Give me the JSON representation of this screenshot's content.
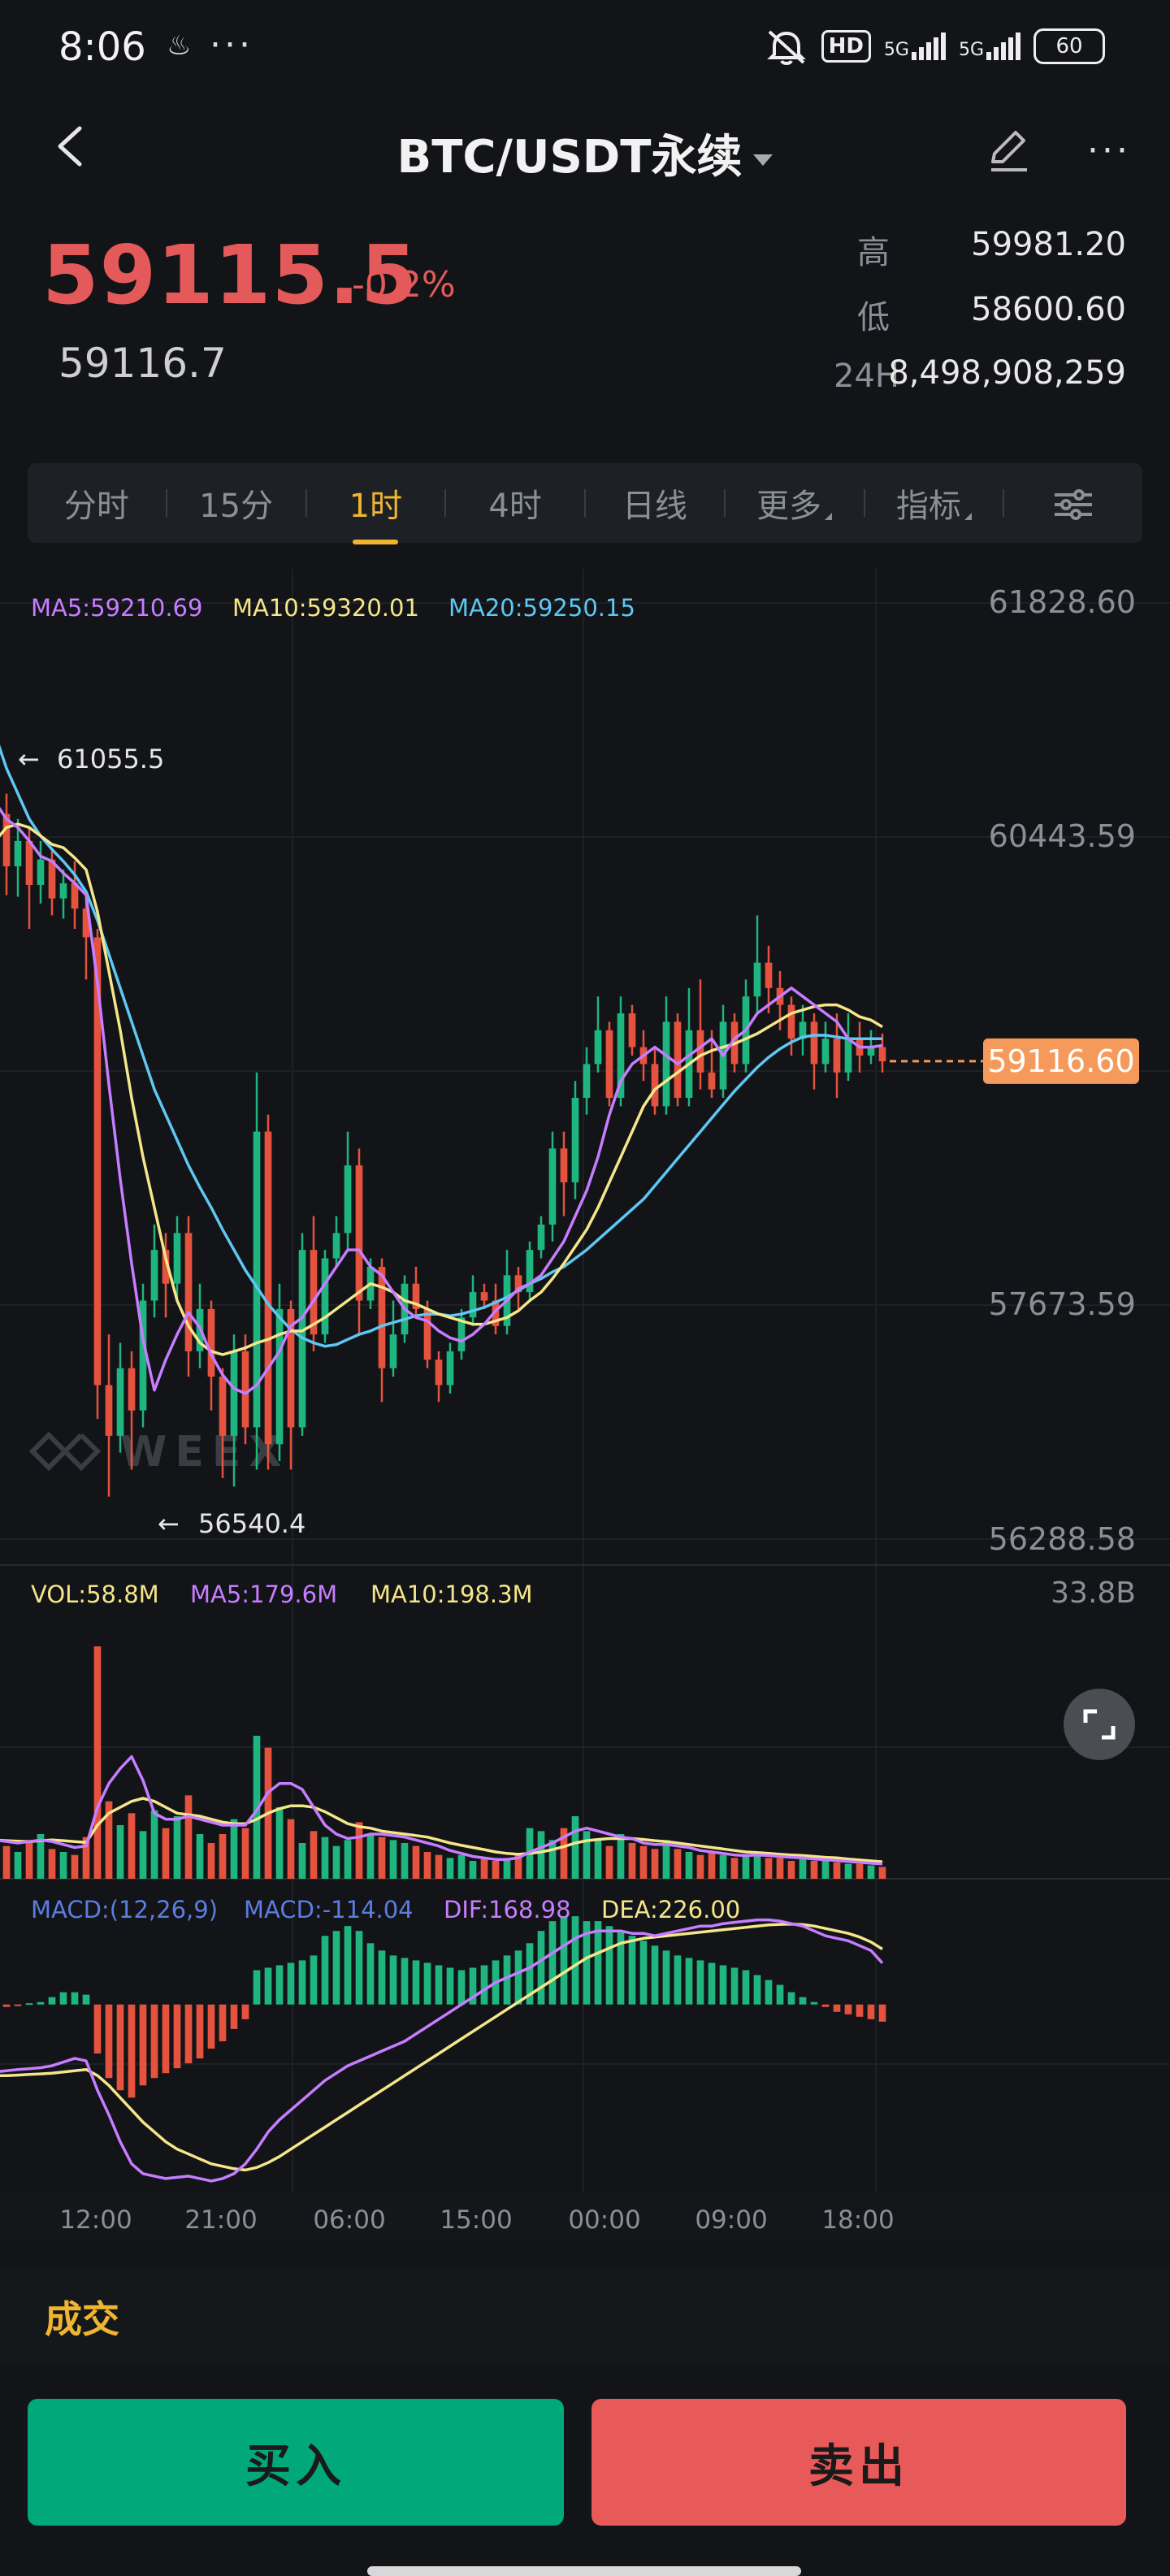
{
  "status_bar": {
    "time": "8:06",
    "glyph": "♨",
    "dots": "···",
    "hd": "HD",
    "net1": "5G",
    "net2": "5G",
    "battery": "60"
  },
  "nav": {
    "title": "BTC/USDT永续",
    "more": "···"
  },
  "price": {
    "last": "59115.5",
    "change": "-0.2%",
    "mark": "59116.7"
  },
  "stats": [
    {
      "label": "高",
      "value": "59981.20"
    },
    {
      "label": "低",
      "value": "58600.60"
    },
    {
      "label": "24H",
      "value": "8,498,908,259"
    }
  ],
  "tabs": [
    "分时",
    "15分",
    "1时",
    "4时",
    "日线",
    "更多",
    "指标"
  ],
  "active_tab": "1时",
  "colors": {
    "up": "#1fb57f",
    "down": "#e5533f",
    "ma5": "#c77dff",
    "ma10": "#f5e68a",
    "ma20": "#5ec8f2",
    "accent": "#f0b530",
    "bg": "#121417"
  },
  "chart_data": {
    "type": "candlestick",
    "main": {
      "legend": [
        {
          "name": "MA5",
          "text": "MA5:59210.69"
        },
        {
          "name": "MA10",
          "text": "MA10:59320.01"
        },
        {
          "name": "MA20",
          "text": "MA20:59250.15"
        }
      ],
      "y_labels": [
        "61828.60",
        "60443.59",
        "57673.59",
        "56288.58"
      ],
      "ylim": [
        56288.58,
        61828.6
      ],
      "high_mark": "61055.5",
      "low_mark": "56540.4",
      "current_price": "59116.60",
      "watermark": "WEEX",
      "candles": [
        [
          60440,
          60830,
          60310,
          61055
        ],
        [
          60830,
          60580,
          60450,
          60980
        ],
        [
          60580,
          60270,
          60100,
          60700
        ],
        [
          60270,
          60420,
          60090,
          60550
        ],
        [
          60420,
          60160,
          59900,
          60500
        ],
        [
          60160,
          60310,
          60050,
          60420
        ],
        [
          60310,
          60080,
          59980,
          60380
        ],
        [
          60080,
          60170,
          59960,
          60250
        ],
        [
          60170,
          60020,
          59900,
          60300
        ],
        [
          60020,
          59850,
          59600,
          60100
        ],
        [
          59850,
          57200,
          57000,
          59900
        ],
        [
          57200,
          56900,
          56540,
          57500
        ],
        [
          56900,
          57300,
          56800,
          57450
        ],
        [
          57300,
          57050,
          56700,
          57400
        ],
        [
          57050,
          57700,
          56950,
          57800
        ],
        [
          57700,
          58000,
          57600,
          58150
        ],
        [
          58000,
          57800,
          57600,
          58100
        ],
        [
          57800,
          58100,
          57700,
          58200
        ],
        [
          58100,
          57400,
          57250,
          58200
        ],
        [
          57400,
          57650,
          57300,
          57800
        ],
        [
          57650,
          57250,
          57050,
          57700
        ],
        [
          57250,
          56900,
          56650,
          57300
        ],
        [
          56900,
          57400,
          56600,
          57500
        ],
        [
          57400,
          56950,
          56850,
          57500
        ],
        [
          56950,
          58700,
          56700,
          59050
        ],
        [
          58700,
          56850,
          56700,
          58800
        ],
        [
          56850,
          57650,
          56750,
          57800
        ],
        [
          57650,
          56950,
          56700,
          57700
        ],
        [
          56950,
          58000,
          56900,
          58100
        ],
        [
          58000,
          57500,
          57400,
          58200
        ],
        [
          57500,
          57950,
          57450,
          58000
        ],
        [
          57950,
          58100,
          57900,
          58200
        ],
        [
          58100,
          58500,
          58000,
          58700
        ],
        [
          58500,
          57700,
          57500,
          58600
        ],
        [
          57700,
          57900,
          57650,
          57950
        ],
        [
          57900,
          57300,
          57100,
          57950
        ],
        [
          57300,
          57500,
          57250,
          57700
        ],
        [
          57500,
          57800,
          57450,
          57850
        ],
        [
          57800,
          57650,
          57600,
          57900
        ],
        [
          57650,
          57350,
          57300,
          57700
        ],
        [
          57350,
          57200,
          57100,
          57400
        ],
        [
          57200,
          57400,
          57150,
          57450
        ],
        [
          57400,
          57600,
          57350,
          57650
        ],
        [
          57600,
          57750,
          57550,
          57850
        ],
        [
          57750,
          57700,
          57650,
          57800
        ],
        [
          57700,
          57550,
          57500,
          57800
        ],
        [
          57550,
          57850,
          57500,
          58000
        ],
        [
          57850,
          57750,
          57650,
          57900
        ],
        [
          57750,
          58000,
          57700,
          58050
        ],
        [
          58000,
          58150,
          57950,
          58200
        ],
        [
          58150,
          58600,
          58050,
          58700
        ],
        [
          58600,
          58400,
          58200,
          58700
        ],
        [
          58400,
          58900,
          58300,
          59000
        ],
        [
          58900,
          59100,
          58800,
          59200
        ],
        [
          59100,
          59300,
          59050,
          59500
        ],
        [
          59300,
          58900,
          58850,
          59350
        ],
        [
          58900,
          59400,
          58850,
          59500
        ],
        [
          59400,
          59200,
          59150,
          59450
        ],
        [
          59200,
          59100,
          59000,
          59300
        ],
        [
          59100,
          58850,
          58800,
          59200
        ],
        [
          58850,
          59350,
          58800,
          59500
        ],
        [
          59350,
          58900,
          58850,
          59400
        ],
        [
          58900,
          59300,
          58850,
          59550
        ],
        [
          59300,
          59050,
          58950,
          59600
        ],
        [
          59050,
          58950,
          58900,
          59300
        ],
        [
          58950,
          59350,
          58900,
          59450
        ],
        [
          59350,
          59100,
          59050,
          59400
        ],
        [
          59100,
          59500,
          59050,
          59600
        ],
        [
          59500,
          59700,
          59400,
          59980
        ],
        [
          59700,
          59550,
          59400,
          59800
        ],
        [
          59550,
          59450,
          59300,
          59650
        ],
        [
          59450,
          59250,
          59150,
          59500
        ],
        [
          59250,
          59350,
          59150,
          59450
        ],
        [
          59350,
          59100,
          58950,
          59400
        ],
        [
          59100,
          59250,
          59050,
          59350
        ],
        [
          59250,
          59050,
          58900,
          59400
        ],
        [
          59050,
          59250,
          59000,
          59400
        ],
        [
          59250,
          59150,
          59050,
          59350
        ],
        [
          59150,
          59200,
          59100,
          59300
        ],
        [
          59200,
          59116,
          59050,
          59280
        ]
      ],
      "ma5": [
        60600,
        60650,
        60550,
        60500,
        60420,
        60330,
        60300,
        60230,
        60170,
        60100,
        59580,
        58980,
        58420,
        57920,
        57470,
        57170,
        57350,
        57500,
        57630,
        57540,
        57380,
        57260,
        57180,
        57150,
        57200,
        57300,
        57400,
        57550,
        57600,
        57700,
        57800,
        57900,
        58000,
        58000,
        57900,
        57850,
        57750,
        57650,
        57600,
        57580,
        57520,
        57480,
        57460,
        57500,
        57560,
        57640,
        57700,
        57770,
        57800,
        57850,
        57950,
        58050,
        58200,
        58350,
        58550,
        58800,
        59000,
        59100,
        59150,
        59200,
        59150,
        59100,
        59150,
        59200,
        59250,
        59150,
        59250,
        59300,
        59400,
        59450,
        59500,
        59550,
        59500,
        59450,
        59400,
        59350,
        59250,
        59200,
        59200,
        59210
      ],
      "ma10": [
        60350,
        60420,
        60500,
        60520,
        60500,
        60450,
        60400,
        60380,
        60320,
        60250,
        60000,
        59650,
        59300,
        58900,
        58550,
        58250,
        57950,
        57700,
        57550,
        57450,
        57400,
        57380,
        57400,
        57420,
        57450,
        57470,
        57500,
        57520,
        57520,
        57560,
        57600,
        57650,
        57700,
        57750,
        57800,
        57780,
        57750,
        57700,
        57680,
        57650,
        57620,
        57600,
        57580,
        57560,
        57560,
        57580,
        57600,
        57640,
        57700,
        57750,
        57830,
        57920,
        58020,
        58120,
        58250,
        58400,
        58550,
        58700,
        58850,
        58950,
        59000,
        59050,
        59100,
        59150,
        59180,
        59200,
        59220,
        59250,
        59280,
        59320,
        59360,
        59400,
        59420,
        59440,
        59450,
        59450,
        59420,
        59380,
        59360,
        59320
      ],
      "ma20": [
        61200,
        61050,
        60850,
        60700,
        60550,
        60450,
        60370,
        60300,
        60220,
        60120,
        59950,
        59750,
        59550,
        59350,
        59150,
        58950,
        58800,
        58650,
        58500,
        58370,
        58250,
        58120,
        58000,
        57880,
        57780,
        57680,
        57600,
        57530,
        57480,
        57450,
        57430,
        57440,
        57470,
        57500,
        57520,
        57550,
        57570,
        57590,
        57610,
        57620,
        57620,
        57610,
        57620,
        57640,
        57660,
        57690,
        57720,
        57760,
        57800,
        57830,
        57870,
        57900,
        57950,
        58000,
        58060,
        58120,
        58180,
        58240,
        58300,
        58380,
        58460,
        58540,
        58620,
        58700,
        58780,
        58860,
        58940,
        59010,
        59080,
        59140,
        59190,
        59230,
        59260,
        59270,
        59270,
        59260,
        59250,
        59250,
        59250,
        59250
      ]
    },
    "volume": {
      "legend": [
        {
          "name": "VOL",
          "text": "VOL:58.8M"
        },
        {
          "name": "MA5",
          "text": "MA5:179.6M"
        },
        {
          "name": "MA10",
          "text": "MA10:198.3M"
        }
      ],
      "y_label": "33.8B",
      "values": [
        120,
        160,
        110,
        90,
        130,
        150,
        100,
        90,
        80,
        140,
        780,
        260,
        180,
        220,
        160,
        230,
        170,
        210,
        280,
        150,
        120,
        150,
        200,
        170,
        480,
        440,
        240,
        200,
        120,
        160,
        140,
        110,
        130,
        190,
        150,
        140,
        130,
        120,
        110,
        90,
        80,
        70,
        80,
        60,
        70,
        60,
        70,
        80,
        170,
        160,
        130,
        170,
        210,
        160,
        130,
        110,
        150,
        120,
        110,
        100,
        130,
        100,
        90,
        80,
        90,
        80,
        70,
        80,
        90,
        70,
        70,
        60,
        70,
        60,
        60,
        55,
        50,
        50,
        45,
        40
      ],
      "ma5": [
        120,
        130,
        125,
        120,
        125,
        130,
        125,
        115,
        105,
        110,
        240,
        320,
        370,
        410,
        330,
        220,
        200,
        200,
        210,
        200,
        190,
        180,
        180,
        180,
        230,
        290,
        320,
        320,
        300,
        240,
        180,
        150,
        135,
        140,
        150,
        150,
        145,
        140,
        130,
        120,
        110,
        95,
        85,
        75,
        70,
        65,
        65,
        70,
        90,
        105,
        120,
        140,
        160,
        170,
        160,
        150,
        140,
        135,
        120,
        115,
        115,
        110,
        105,
        95,
        90,
        85,
        80,
        78,
        80,
        78,
        75,
        72,
        70,
        66,
        64,
        61,
        58,
        55,
        52,
        50
      ],
      "ma10": [
        125,
        130,
        128,
        126,
        125,
        128,
        130,
        128,
        125,
        122,
        180,
        220,
        240,
        260,
        270,
        260,
        240,
        220,
        215,
        210,
        200,
        190,
        185,
        185,
        200,
        220,
        235,
        245,
        245,
        240,
        225,
        205,
        185,
        175,
        170,
        160,
        155,
        150,
        145,
        140,
        130,
        120,
        112,
        105,
        98,
        90,
        85,
        82,
        85,
        90,
        98,
        108,
        120,
        128,
        132,
        135,
        135,
        135,
        132,
        128,
        125,
        120,
        115,
        110,
        105,
        100,
        95,
        90,
        88,
        85,
        82,
        80,
        78,
        75,
        72,
        70,
        66,
        63,
        60,
        57
      ],
      "ymax": 900
    },
    "macd": {
      "legend": [
        {
          "name": "MACD_PARAMS",
          "text": "MACD:(12,26,9)"
        },
        {
          "name": "MACD",
          "text": "MACD:-114.04"
        },
        {
          "name": "DIF",
          "text": "DIF:168.98"
        },
        {
          "name": "DEA",
          "text": "DEA:226.00"
        }
      ],
      "hist": [
        -40,
        -20,
        -10,
        -5,
        5,
        10,
        30,
        50,
        50,
        40,
        -200,
        -300,
        -350,
        -380,
        -330,
        -300,
        -280,
        -260,
        -240,
        -220,
        -180,
        -150,
        -100,
        -60,
        140,
        150,
        160,
        170,
        180,
        200,
        280,
        300,
        320,
        300,
        250,
        220,
        200,
        190,
        180,
        170,
        160,
        150,
        140,
        150,
        160,
        180,
        200,
        220,
        250,
        300,
        340,
        360,
        360,
        340,
        340,
        320,
        300,
        280,
        260,
        240,
        220,
        200,
        190,
        180,
        170,
        160,
        150,
        140,
        120,
        100,
        80,
        50,
        30,
        10,
        -10,
        -30,
        -40,
        -50,
        -60,
        -70
      ],
      "dif": [
        -280,
        -275,
        -270,
        -265,
        -262,
        -258,
        -250,
        -235,
        -220,
        -230,
        -350,
        -450,
        -560,
        -650,
        -690,
        -700,
        -710,
        -705,
        -700,
        -710,
        -720,
        -710,
        -690,
        -650,
        -590,
        -520,
        -470,
        -430,
        -390,
        -350,
        -310,
        -280,
        -250,
        -230,
        -210,
        -190,
        -170,
        -150,
        -120,
        -90,
        -60,
        -30,
        0,
        30,
        60,
        90,
        110,
        130,
        150,
        180,
        210,
        240,
        270,
        290,
        300,
        300,
        300,
        290,
        290,
        280,
        290,
        300,
        310,
        320,
        320,
        330,
        335,
        340,
        345,
        345,
        340,
        330,
        320,
        300,
        280,
        270,
        260,
        240,
        220,
        169
      ],
      "dea": [
        -290,
        -290,
        -290,
        -288,
        -285,
        -283,
        -280,
        -275,
        -270,
        -265,
        -290,
        -330,
        -380,
        -430,
        -480,
        -520,
        -560,
        -590,
        -610,
        -630,
        -650,
        -660,
        -670,
        -675,
        -665,
        -645,
        -620,
        -590,
        -560,
        -530,
        -500,
        -470,
        -440,
        -410,
        -380,
        -350,
        -320,
        -290,
        -260,
        -230,
        -200,
        -170,
        -140,
        -110,
        -80,
        -50,
        -20,
        10,
        40,
        70,
        100,
        130,
        160,
        190,
        210,
        230,
        250,
        260,
        270,
        275,
        280,
        285,
        290,
        295,
        300,
        305,
        310,
        315,
        320,
        325,
        327,
        328,
        326,
        320,
        310,
        300,
        290,
        275,
        255,
        226
      ],
      "ylim": [
        -760,
        420
      ]
    },
    "x_labels": [
      "12:00",
      "21:00",
      "06:00",
      "15:00",
      "00:00",
      "09:00",
      "18:00"
    ]
  },
  "bottom": {
    "deals_label": "成交",
    "buy_label": "买入",
    "sell_label": "卖出"
  }
}
